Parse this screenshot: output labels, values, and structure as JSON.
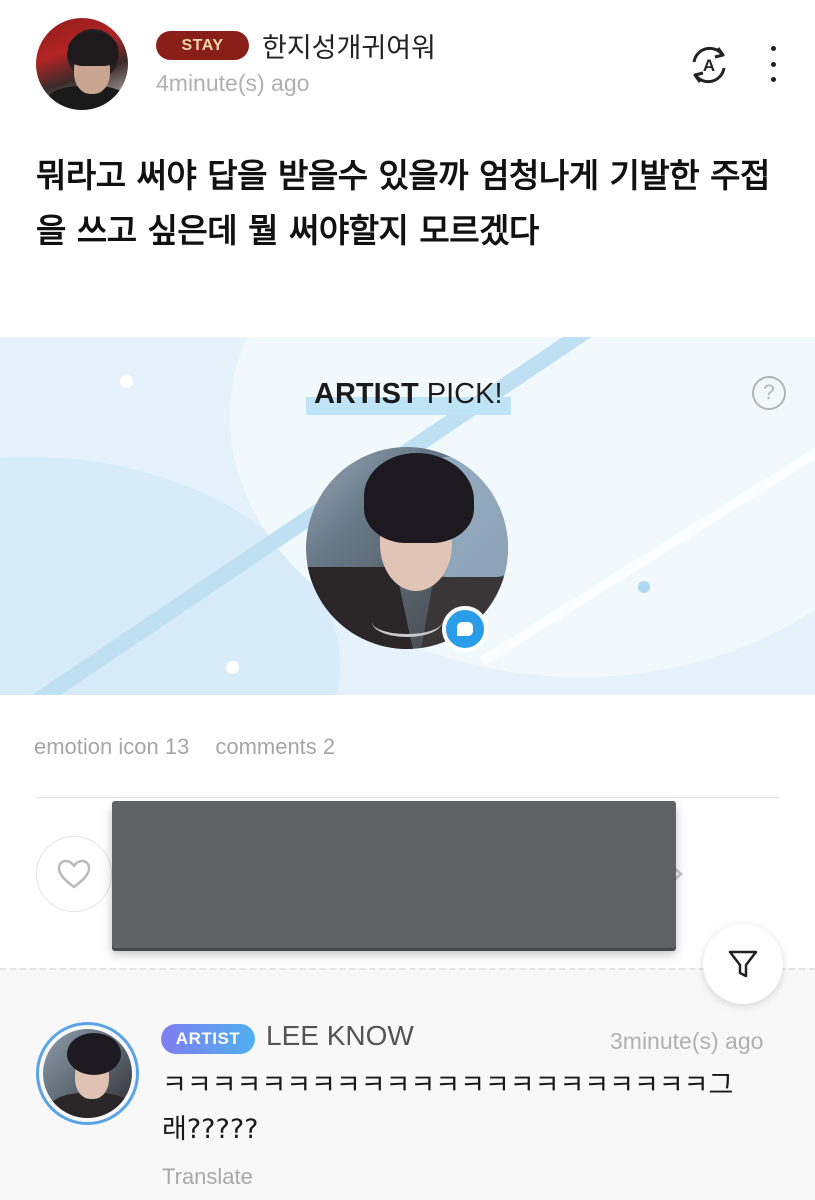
{
  "post": {
    "badge": "STAY",
    "author": "한지성개귀여워",
    "time": "4minute(s) ago",
    "body": "뭐라고 써야 답을 받을수 있을까 엄청나게 기발한 주접을 쓰고 싶은데 뭘 써야할지 모르겠다"
  },
  "artist_pick": {
    "title_bold": "ARTIST",
    "title_rest": " PICK!",
    "help": "?"
  },
  "stats": {
    "emotion": "emotion icon 13",
    "comments": "comments 2"
  },
  "comment": {
    "badge": "ARTIST",
    "name": "LEE KNOW",
    "time": "3minute(s) ago",
    "text": "ㅋㅋㅋㅋㅋㅋㅋㅋㅋㅋㅋㅋㅋㅋㅋㅋㅋㅋㅋㅋㅋㅋ그래?????",
    "translate": "Translate"
  },
  "colors": {
    "stay_badge": "#8a1f1a",
    "artist_badge_start": "#7f7ef0",
    "artist_badge_end": "#4fb0f0",
    "banner_bg": "#e5f2fb"
  },
  "icons": [
    "translate-icon",
    "more-icon",
    "help-icon",
    "chat-bubble-icon",
    "heart-icon",
    "chevron-right-icon",
    "filter-icon"
  ]
}
